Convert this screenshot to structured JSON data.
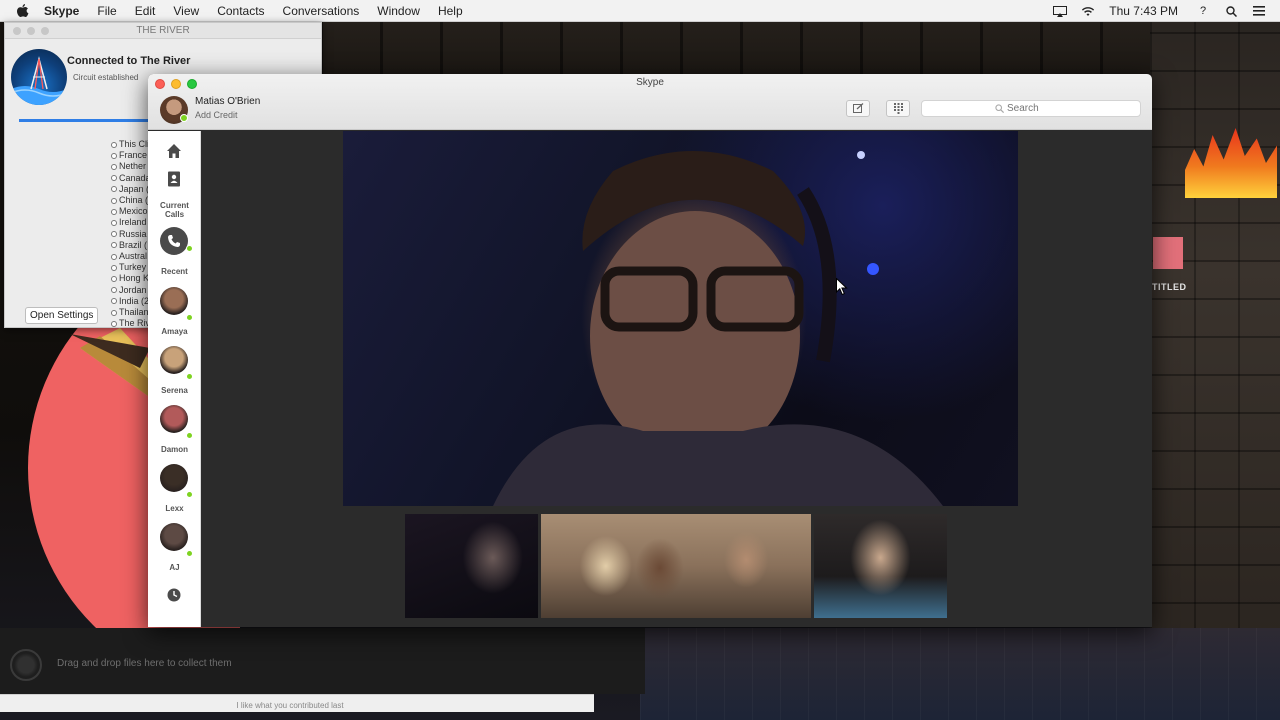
{
  "menubar": {
    "app_name": "Skype",
    "items": [
      "File",
      "Edit",
      "View",
      "Contacts",
      "Conversations",
      "Window",
      "Help"
    ],
    "clock": "Thu 7:43 PM",
    "help_icon": "?"
  },
  "river_window": {
    "title": "THE RIVER",
    "connected_text": "Connected to The River",
    "circuit_text": "Circuit established",
    "progress": 1.0,
    "countries": [
      "This Cli",
      "France",
      "Nether",
      "Canada",
      "Japan (",
      "China (",
      "Mexico",
      "Ireland",
      "Russia",
      "Brazil (",
      "Austral",
      "Turkey",
      "Hong K",
      "Jordan",
      "India (2",
      "Thailan",
      "The Riv"
    ],
    "open_settings_label": "Open Settings"
  },
  "desktop": {
    "titled_label": "TITLED",
    "drop_zone_text": "Drag and drop files here to collect them",
    "bottom_text": "I like what you contributed last"
  },
  "skype": {
    "window_title": "Skype",
    "profile_name": "Matias O'Brien",
    "add_credit": "Add Credit",
    "search_placeholder": "Search",
    "sidebar": {
      "current_calls_label_1": "Current",
      "current_calls_label_2": "Calls",
      "recent_label": "Recent",
      "contacts": [
        {
          "name": "Amaya",
          "color": "#9a6e55"
        },
        {
          "name": "Serena",
          "color": "#c8a27a"
        },
        {
          "name": "Damon",
          "color": "#b25a5a"
        },
        {
          "name": "Lexx",
          "color": "#3a2e26"
        },
        {
          "name": "AJ",
          "color": "#5d4a44"
        }
      ]
    }
  },
  "colors": {
    "online": "#7ed321",
    "skype_bg": "#2b2b2b",
    "pie_red": "#ef6262"
  }
}
